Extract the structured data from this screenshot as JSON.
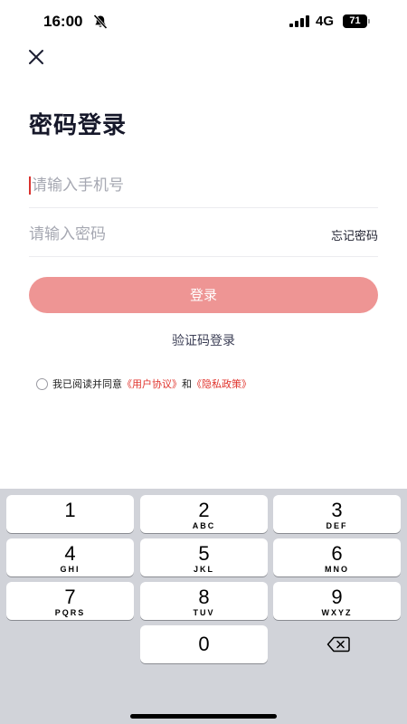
{
  "status_bar": {
    "time": "16:00",
    "network": "4G",
    "battery": "71",
    "icons": [
      "bell-slash-icon",
      "signal-icon",
      "battery-icon"
    ]
  },
  "header": {
    "close_icon": "close-icon"
  },
  "page": {
    "title": "密码登录"
  },
  "form": {
    "phone_placeholder": "请输入手机号",
    "phone_value": "",
    "password_placeholder": "请输入密码",
    "password_value": "",
    "forgot_label": "忘记密码",
    "login_label": "登录",
    "sms_login_label": "验证码登录"
  },
  "agreement": {
    "prefix": "我已阅读并同意",
    "user_agreement": "《用户协议》",
    "connector": "和",
    "privacy_policy": "《隐私政策》",
    "checked": false
  },
  "keyboard": {
    "keys": [
      {
        "digit": "1",
        "letters": ""
      },
      {
        "digit": "2",
        "letters": "ABC"
      },
      {
        "digit": "3",
        "letters": "DEF"
      },
      {
        "digit": "4",
        "letters": "GHI"
      },
      {
        "digit": "5",
        "letters": "JKL"
      },
      {
        "digit": "6",
        "letters": "MNO"
      },
      {
        "digit": "7",
        "letters": "PQRS"
      },
      {
        "digit": "8",
        "letters": "TUV"
      },
      {
        "digit": "9",
        "letters": "WXYZ"
      },
      {
        "digit": "0",
        "letters": ""
      }
    ],
    "delete_icon": "backspace-icon"
  },
  "colors": {
    "accent": "#ee9594",
    "link": "#e0332c",
    "title": "#16182a",
    "keyboard_bg": "#d1d3d9"
  }
}
